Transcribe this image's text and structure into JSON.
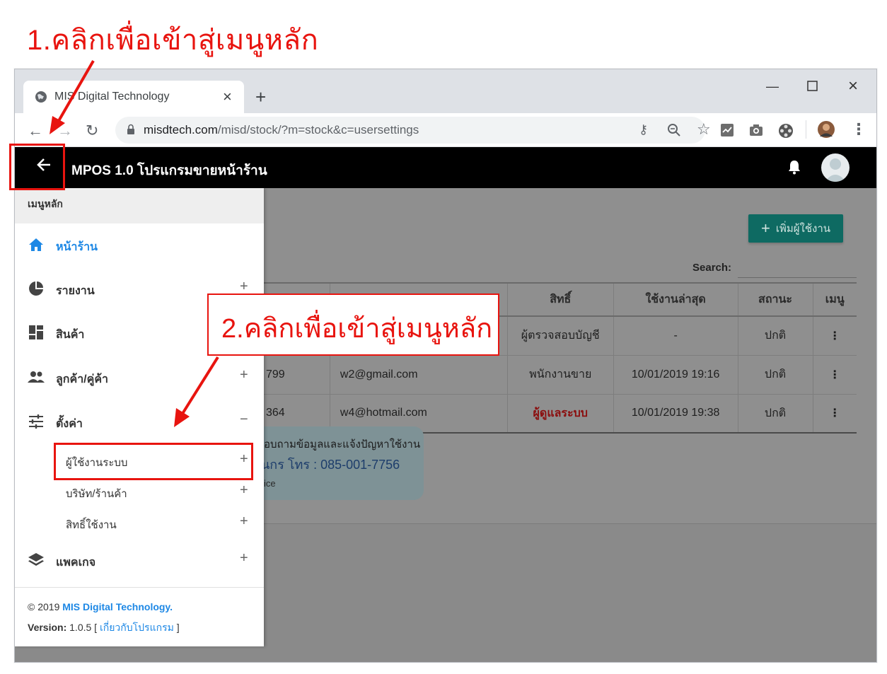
{
  "annotations": {
    "step1": "1.คลิกเพื่อเข้าสู่เมนูหลัก",
    "step2": "2.คลิกเพื่อเข้าสู่เมนูหลัก",
    "color": "#e8140f"
  },
  "browser": {
    "tab_title": "MIS Digital Technology",
    "url_host": "misdtech.com",
    "url_path": "/misd/stock/?m=stock&c=usersettings",
    "new_tab": "+",
    "close_tab": "×",
    "icons": [
      "globe-icon",
      "back-icon",
      "forward-icon",
      "reload-icon",
      "lock-icon",
      "key-icon",
      "zoom-icon",
      "star-icon",
      "chart-ext-icon",
      "camera-ext-icon",
      "film-ext-icon",
      "profile-icon",
      "more-icon"
    ]
  },
  "app": {
    "title": "MPOS 1.0 โปรแกรมขายหน้าร้าน",
    "header_color": "#000000",
    "add_user_label": "เพิ่มผู้ใช้งาน",
    "add_user_color": "#0e6a62",
    "search_label": "Search:"
  },
  "table": {
    "headers": [
      "สิทธิ์",
      "ใช้งานล่าสุด",
      "สถานะ",
      "เมนู"
    ],
    "rows": [
      {
        "phone": "",
        "email": "",
        "role": "ผู้ตรวจสอบบัญชี",
        "last": "-",
        "status": "ปกติ"
      },
      {
        "phone": "799",
        "email": "w2@gmail.com",
        "role": "พนักงานขาย",
        "last": "10/01/2019 19:16",
        "status": "ปกติ"
      },
      {
        "phone": "364",
        "email": "w4@hotmail.com",
        "role": "ผู้ดูแลระบบ",
        "last": "10/01/2019 19:38",
        "status": "ปกติ"
      }
    ],
    "menu_glyph": "⋮"
  },
  "contact": {
    "line1": "อบถามข้อมูลและแจ้งปัญหาใช้งาน",
    "line2": "นกร โทร : 085-001-7756",
    "line3": "ice"
  },
  "sidebar": {
    "header": "เมนูหลัก",
    "items": [
      {
        "label": "หน้าร้าน",
        "icon": "home-icon",
        "active": true
      },
      {
        "label": "รายงาน",
        "icon": "pie-chart-icon",
        "toggle": "+"
      },
      {
        "label": "สินค้า",
        "icon": "dashboard-icon",
        "toggle": ""
      },
      {
        "label": "ลูกค้า/คู่ค้า",
        "icon": "people-icon",
        "toggle": "+"
      },
      {
        "label": "ตั้งค่า",
        "icon": "sliders-icon",
        "toggle": "−"
      },
      {
        "label": "แพคเกจ",
        "icon": "layers-icon",
        "toggle": "+"
      }
    ],
    "subitems": [
      {
        "label": "ผู้ใช้งานระบบ",
        "toggle": "+"
      },
      {
        "label": "บริษัท/ร้านค้า",
        "toggle": "+"
      },
      {
        "label": "สิทธิ์ใช้งาน",
        "toggle": "+"
      }
    ],
    "copyright_prefix": "© 2019",
    "copyright_link": "MIS Digital Technology.",
    "version_label": "Version:",
    "version_value": "1.0.5",
    "about_link": "เกี่ยวกับโปรแกรม",
    "accent": "#1e88e5"
  }
}
